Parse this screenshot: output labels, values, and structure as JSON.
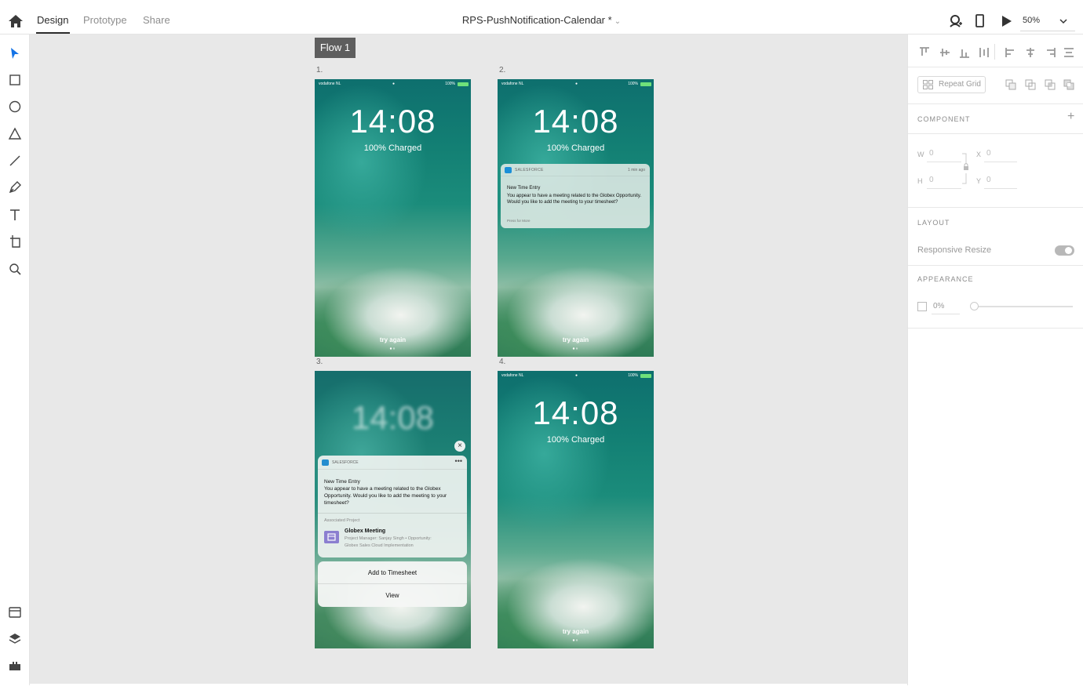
{
  "topbar": {
    "tabs": [
      {
        "label": "Design",
        "active": true
      },
      {
        "label": "Prototype",
        "active": false
      },
      {
        "label": "Share",
        "active": false
      }
    ],
    "doc_title": "RPS-PushNotification-Calendar *",
    "zoom": "50%"
  },
  "left_tools": [
    "select-tool-icon",
    "rectangle-tool-icon",
    "ellipse-tool-icon",
    "triangle-tool-icon",
    "line-tool-icon",
    "pen-tool-icon",
    "text-tool-icon",
    "artboard-tool-icon",
    "zoom-tool-icon"
  ],
  "canvas": {
    "flow_label": "Flow 1",
    "artboards": [
      {
        "num": "1.",
        "status": {
          "carrier": "vodafone NL",
          "battery": "100%"
        },
        "time": "14:08",
        "charged": "100% Charged",
        "try_again": "try again"
      },
      {
        "num": "2.",
        "status": {
          "carrier": "vodafone NL",
          "battery": "100%"
        },
        "time": "14:08",
        "charged": "100% Charged",
        "try_again": "try again",
        "notification": {
          "app": "SALESFORCE",
          "ago": "1 min ago",
          "title": "New Time Entry",
          "body": "You appear to have a meeting related to the Globex Opportunity. Would you like to add the meeting to your timesheet?",
          "more": "Press for More"
        }
      },
      {
        "num": "3.",
        "time": "14:08",
        "card": {
          "app": "SALESFORCE",
          "ellipsis": "•••",
          "title": "New Time Entry",
          "body": "You appear to have a meeting related to the Globex Opportunity. Would you like to add the meeting to your timesheet?",
          "assoc_label": "Associated Project",
          "project_title": "Globex Meeting",
          "project_line1": "Project Manager: Sanjay Singh • Opportunity:",
          "project_line2": "Globex Sales Cloud Implementation"
        },
        "actions": [
          "Add to Timesheet",
          "View"
        ],
        "close": "×"
      },
      {
        "num": "4.",
        "status": {
          "carrier": "vodafone NL",
          "battery": "100%"
        },
        "time": "14:08",
        "charged": "100% Charged",
        "try_again": "try again"
      }
    ]
  },
  "right_panel": {
    "repeat_grid": "Repeat Grid",
    "component_title": "COMPONENT",
    "w_label": "W",
    "w_value": "0",
    "h_label": "H",
    "h_value": "0",
    "x_label": "X",
    "x_value": "0",
    "y_label": "Y",
    "y_value": "0",
    "layout_title": "LAYOUT",
    "responsive_resize": "Responsive Resize",
    "responsive_on": true,
    "appearance_title": "APPEARANCE",
    "opacity": "0%"
  },
  "colors": {
    "accent": "#1473e6",
    "canvas": "#e8e8e8",
    "flow_label": "#5e5e5e"
  }
}
